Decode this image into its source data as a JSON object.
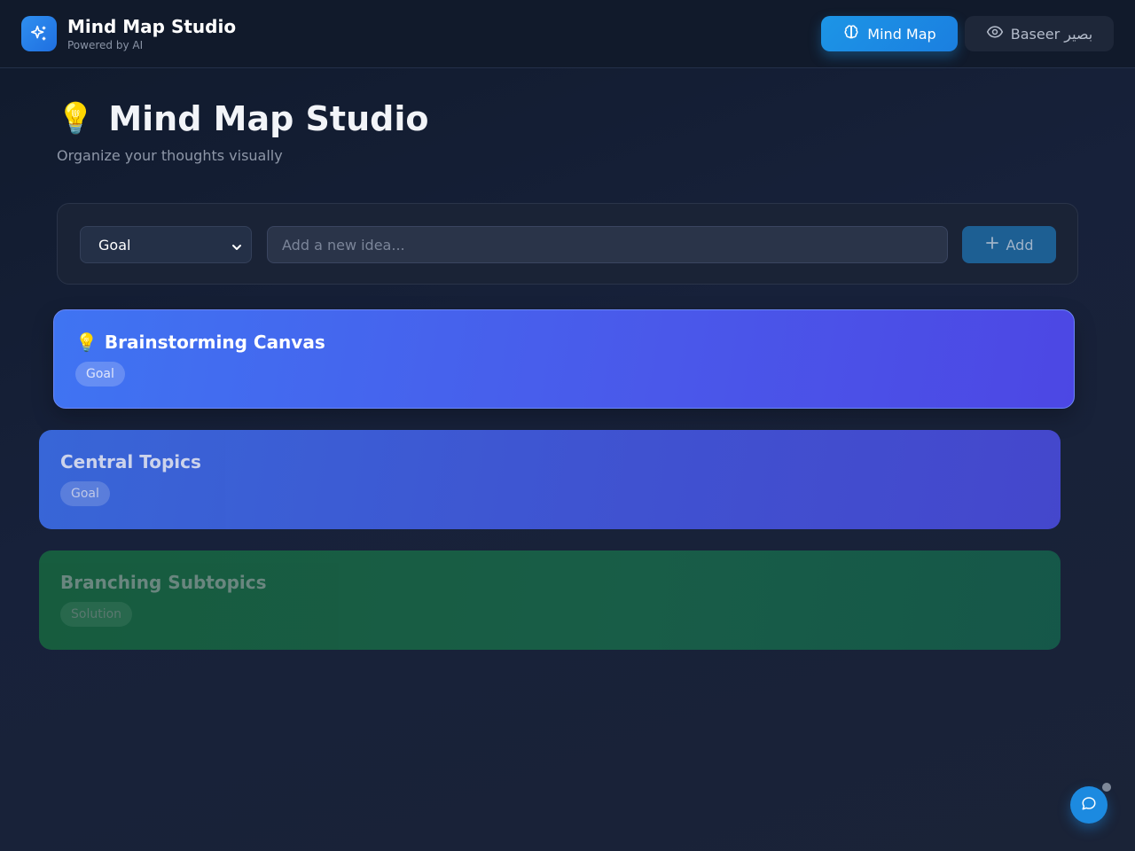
{
  "header": {
    "brand_title": "Mind Map Studio",
    "brand_subtitle": "Powered by AI",
    "logo_icon": "sparkles-icon",
    "nav": [
      {
        "label": "Mind Map",
        "icon": "brain-icon",
        "active": true
      },
      {
        "label": "Baseer بصير",
        "icon": "eye-icon",
        "active": false
      }
    ]
  },
  "hero": {
    "emoji": "💡",
    "title": "Mind Map Studio",
    "subtitle": "Organize your thoughts visually"
  },
  "composer": {
    "type_selected": "Goal",
    "input_placeholder": "Add a new idea...",
    "input_value": "",
    "add_label": "Add",
    "add_icon": "plus-icon"
  },
  "nodes": [
    {
      "emoji": "💡",
      "title": "Brainstorming Canvas",
      "tag": "Goal",
      "color": "#4a5cec"
    },
    {
      "emoji": "",
      "title": "Central Topics",
      "tag": "Goal",
      "color": "#4254d8"
    },
    {
      "emoji": "",
      "title": "Branching Subtopics",
      "tag": "Solution",
      "color": "#186048"
    }
  ],
  "chat": {
    "icon": "chat-bubble-icon"
  },
  "colors": {
    "accent": "#1c95e6",
    "background": "#17213a",
    "goal": "#4a5cec",
    "solution": "#186048"
  }
}
